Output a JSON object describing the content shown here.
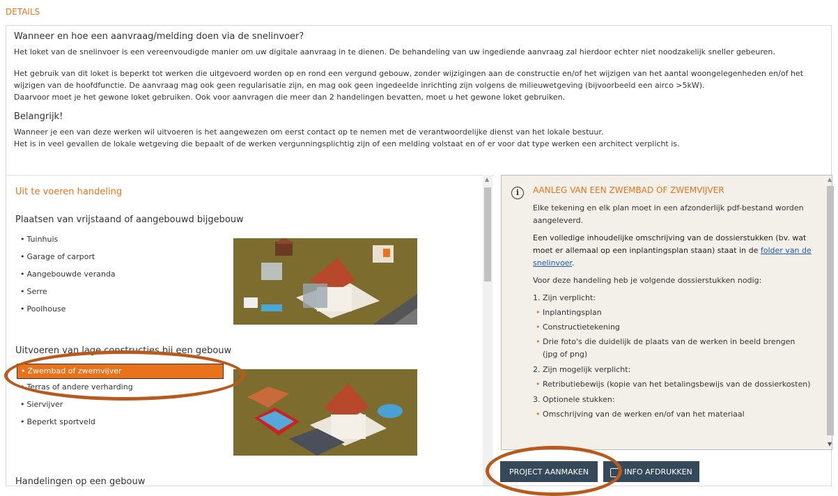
{
  "header": {
    "details_label": "DETAILS"
  },
  "intro": {
    "title": "Wanneer en hoe een aanvraag/melding doen via de snelinvoer?",
    "p1": "Het loket van de snelinvoer is een vereenvoudigde manier om uw digitale aanvraag in te dienen. De behandeling van uw ingediende aanvraag zal hierdoor echter niet noodzakelijk sneller gebeuren.",
    "p2": "Het gebruik van dit loket is beperkt tot werken die uitgevoerd worden op en rond een vergund gebouw, zonder wijzigingen aan de constructie en/of het wijzigen van het aantal woongelegenheden en/of het wijzigen van de hoofdfunctie. De aanvraag mag ook geen regularisatie zijn, en mag ook geen ingedeelde inrichting zijn volgens de milieuwetgeving (bijvoorbeeld een airco >5kW).",
    "p3": "Daarvoor moet je het gewone loket gebruiken. Ook voor aanvragen die meer dan 2 handelingen bevatten, moet u het gewone loket gebruiken.",
    "important_title": "Belangrijk!",
    "p4": "Wanneer je een van deze werken wil uitvoeren is het aangewezen om eerst contact op te nemen met de verantwoordelijke dienst van het lokale bestuur.",
    "p5": "Het is in veel gevallen de lokale wetgeving die bepaalt of de werken vergunningsplichtig zijn of een melding volstaat en of er voor dat type werken een architect verplicht is."
  },
  "left": {
    "section_title": "Uit te voeren handeling",
    "categories": [
      {
        "title": "Plaatsen van vrijstaand of aangebouwd bijgebouw",
        "items": [
          "Tuinhuis",
          "Garage of carport",
          "Aangebouwde veranda",
          "Serre",
          "Poolhouse"
        ]
      },
      {
        "title": "Uitvoeren van lage constructies bij een gebouw",
        "items": [
          "Zwembad of zwemvijver",
          "Terras of andere verharding",
          "Siervijver",
          "Beperkt sportveld"
        ]
      },
      {
        "title": "Handelingen op een gebouw"
      }
    ]
  },
  "info": {
    "icon": "info-icon",
    "title": "AANLEG VAN EEN ZWEMBAD OF ZWEMVIJVER",
    "p1": "Elke tekening en elk plan moet in een afzonderlijk pdf-bestand worden aangeleverd.",
    "p2_before": "Een volledige inhoudelijke omschrijving van de dossierstukken (bv. wat moet er allemaal op een inplantingsplan staan) staat in de ",
    "p2_link": "folder van de snelinvoer",
    "p2_after": ".",
    "p3": "Voor deze handeling heb je volgende dossierstukken nodig:",
    "req_title": "1. Zijn verplicht:",
    "req_items": [
      "Inplantingsplan",
      "Constructietekening",
      "Drie foto's die duidelijk de plaats van de werken in beeld brengen (jpg of png)"
    ],
    "maybe_title": "2. Zijn mogelijk verplicht:",
    "maybe_items": [
      "Retributiebewijs (kopie van het betalingsbewijs van de dossierkosten)"
    ],
    "opt_title": "3. Optionele stukken:",
    "opt_items": [
      "Omschrijving van de werken en/of van het materiaal"
    ]
  },
  "buttons": {
    "project": "PROJECT AANMAKEN",
    "print": "INFO AFDRUKKEN"
  },
  "colors": {
    "accent": "#e8731a",
    "button": "#34495a",
    "annotation": "#b85a1c"
  }
}
